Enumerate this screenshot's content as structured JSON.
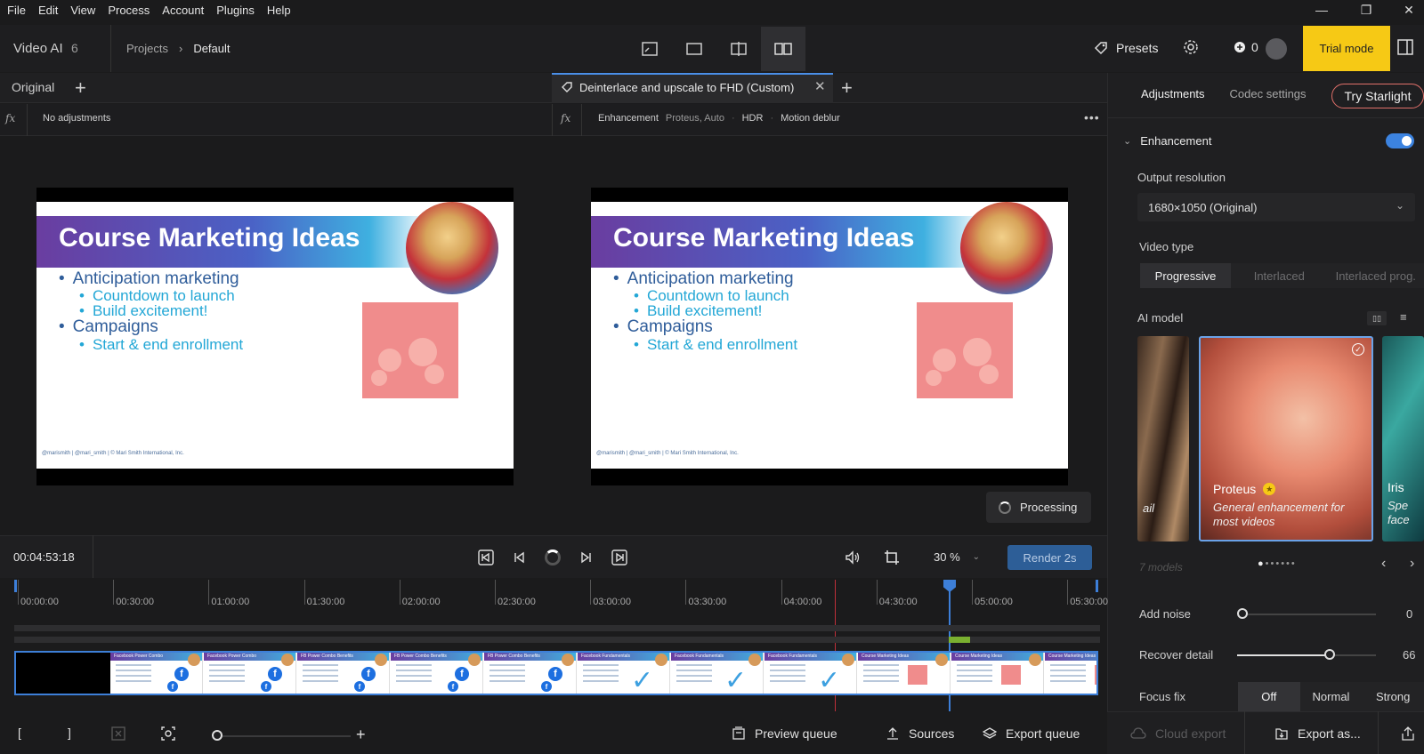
{
  "menu": [
    "File",
    "Edit",
    "View",
    "Process",
    "Account",
    "Plugins",
    "Help"
  ],
  "app": {
    "title": "Video AI",
    "version": "6"
  },
  "breadcrumb": {
    "parent": "Projects",
    "current": "Default"
  },
  "header": {
    "presets_label": "Presets",
    "credits": "0",
    "trial_label": "Trial mode"
  },
  "tabs": {
    "original_label": "Original",
    "enhanced_label": "Deinterlace and upscale to FHD (Custom)"
  },
  "info": {
    "fx": "fx",
    "original_text": "No adjustments",
    "enh_label": "Enhancement",
    "enh_detail": "Proteus, Auto",
    "hdr": "HDR",
    "motion": "Motion deblur"
  },
  "slide": {
    "title": "Course Marketing Ideas",
    "b1": "Anticipation marketing",
    "b1a": "Countdown to launch",
    "b1b": "Build excitement!",
    "b2": "Campaigns",
    "b2a": "Start & end enrollment",
    "footer": "@marismith | @mari_smith | © Mari Smith International, Inc."
  },
  "processing_label": "Processing",
  "transport": {
    "timecode": "00:04:53:18",
    "zoom": "30 %",
    "render_label": "Render 2s"
  },
  "ruler": [
    "00:00:00",
    "00:30:00",
    "01:00:00",
    "01:30:00",
    "02:00:00",
    "02:30:00",
    "03:00:00",
    "03:30:00",
    "04:00:00",
    "04:30:00",
    "05:00:00",
    "05:30:00"
  ],
  "thumbnails": [
    {
      "title": "Facebook Power Combo",
      "kind": "fb"
    },
    {
      "title": "Facebook Power Combo",
      "kind": "fb"
    },
    {
      "title": "FB Power Combo Benefits",
      "kind": "fb"
    },
    {
      "title": "FB Power Combo Benefits",
      "kind": "fb"
    },
    {
      "title": "FB Power Combo Benefits",
      "kind": "fb"
    },
    {
      "title": "Facebook Fundamentals",
      "kind": "check"
    },
    {
      "title": "Facebook Fundamentals",
      "kind": "check"
    },
    {
      "title": "Facebook Fundamentals",
      "kind": "check"
    },
    {
      "title": "Course Marketing Ideas",
      "kind": "pink"
    },
    {
      "title": "Course Marketing Ideas",
      "kind": "pink"
    },
    {
      "title": "Course Marketing Ideas",
      "kind": "pink"
    }
  ],
  "bottombar": {
    "preview_queue": "Preview queue",
    "sources": "Sources",
    "export_queue": "Export queue",
    "cloud_export": "Cloud export",
    "export_as": "Export as..."
  },
  "panel": {
    "tab_adjustments": "Adjustments",
    "tab_codec": "Codec settings",
    "try_starlight": "Try Starlight",
    "enhancement": "Enhancement",
    "output_resolution_label": "Output resolution",
    "output_resolution_value": "1680×1050 (Original)",
    "video_type_label": "Video type",
    "video_types": [
      "Progressive",
      "Interlaced",
      "Interlaced prog."
    ],
    "ai_model_label": "AI model",
    "model_prev_fragment": "ail",
    "model_name": "Proteus",
    "model_desc": "General enhancement for most videos",
    "model_next_name": "Iris",
    "model_next_desc": "Spe face",
    "models_count": "7 models",
    "add_noise_label": "Add noise",
    "add_noise_value": "0",
    "recover_detail_label": "Recover detail",
    "recover_detail_value": "66",
    "focus_fix_label": "Focus fix",
    "focus_options": [
      "Off",
      "Normal",
      "Strong"
    ]
  },
  "colors": {
    "accent": "#3c83e0",
    "trial": "#f6c915",
    "starlight_border": "#e0706a"
  }
}
